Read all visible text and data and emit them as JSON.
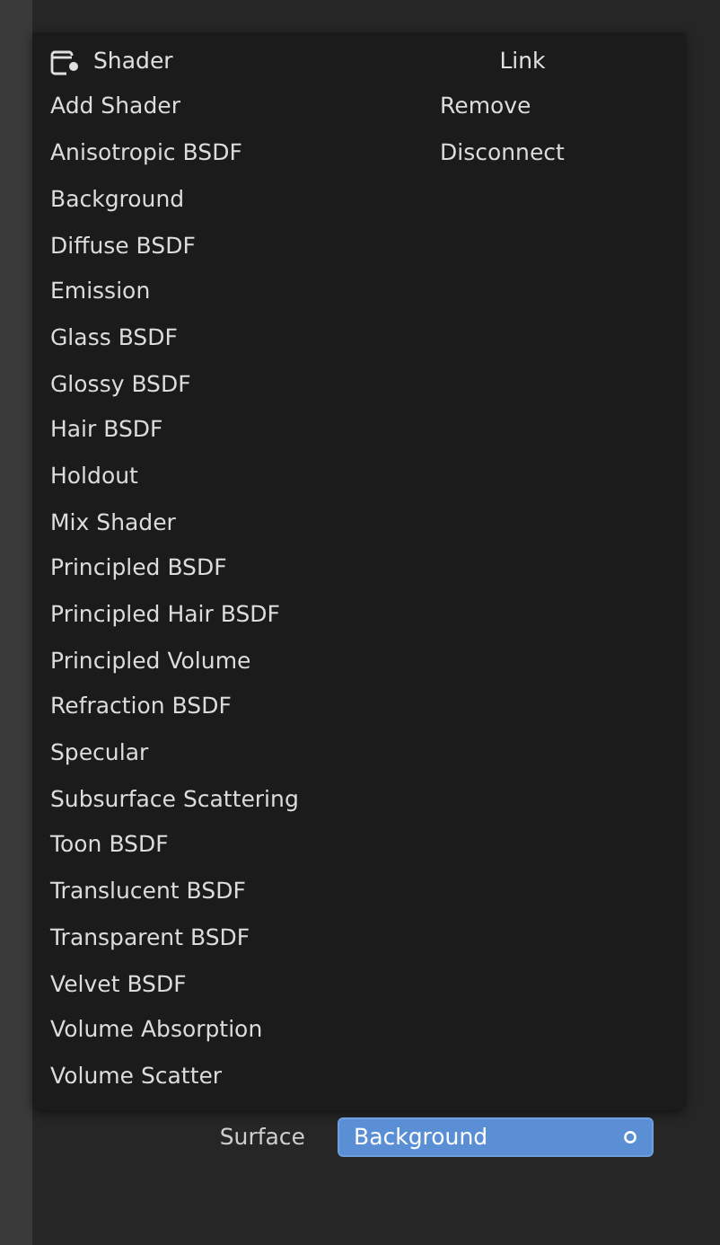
{
  "menu": {
    "columns": [
      {
        "title": "Shader",
        "items": [
          "Add Shader",
          "Anisotropic BSDF",
          "Background",
          "Diffuse BSDF",
          "Emission",
          "Glass BSDF",
          "Glossy BSDF",
          "Hair BSDF",
          "Holdout",
          "Mix Shader",
          "Principled BSDF",
          "Principled Hair BSDF",
          "Principled Volume",
          "Refraction BSDF",
          "Specular",
          "Subsurface Scattering",
          "Toon BSDF",
          "Translucent BSDF",
          "Transparent BSDF",
          "Velvet BSDF",
          "Volume Absorption",
          "Volume Scatter"
        ]
      },
      {
        "title": "Link",
        "items": [
          "Remove",
          "Disconnect"
        ]
      }
    ]
  },
  "surface": {
    "label": "Surface",
    "value": "Background"
  }
}
